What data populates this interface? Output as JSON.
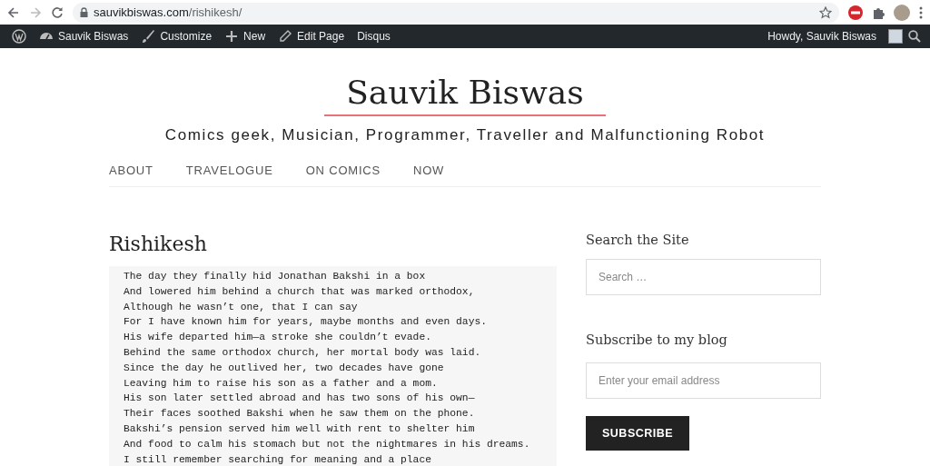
{
  "browser": {
    "url_host": "sauvikbiswas.com",
    "url_path": "/rishikesh/"
  },
  "admin_bar": {
    "items": [
      {
        "kind": "wp"
      },
      {
        "kind": "dashboard",
        "label": "Sauvik Biswas"
      },
      {
        "kind": "brush",
        "label": "Customize"
      },
      {
        "kind": "plus",
        "label": "New"
      },
      {
        "kind": "pencil",
        "label": "Edit Page"
      },
      {
        "kind": "text",
        "label": "Disqus"
      }
    ],
    "greeting": "Howdy, Sauvik Biswas"
  },
  "site": {
    "title": "Sauvik Biswas",
    "tagline": "Comics geek, Musician, Programmer, Traveller and Malfunctioning Robot"
  },
  "nav": [
    "ABOUT",
    "TRAVELOGUE",
    "ON COMICS",
    "NOW"
  ],
  "post": {
    "title": "Rishikesh",
    "lines": [
      "The day they finally hid Jonathan Bakshi in a box",
      "And lowered him behind a church that was marked orthodox,",
      "Although he wasn’t one, that I can say",
      "For I have known him for years, maybe months and even days.",
      "His wife departed him—a stroke she couldn’t evade.",
      "Behind the same orthodox church, her mortal body was laid.",
      "Since the day he outlived her, two decades have gone",
      "Leaving him to raise his son as a father and a mom.",
      "His son later settled abroad and has two sons of his own—",
      "Their faces soothed Bakshi when he saw them on the phone.",
      "Bakshi’s pension served him well with rent to shelter him",
      "And food to calm his stomach but not the nightmares in his dreams.",
      "I still remember searching for meaning and a place"
    ]
  },
  "sidebar": {
    "search_title": "Search the Site",
    "search_placeholder": "Search …",
    "subscribe_title": "Subscribe to my blog",
    "email_placeholder": "Enter your email address",
    "button": "SUBSCRIBE"
  }
}
